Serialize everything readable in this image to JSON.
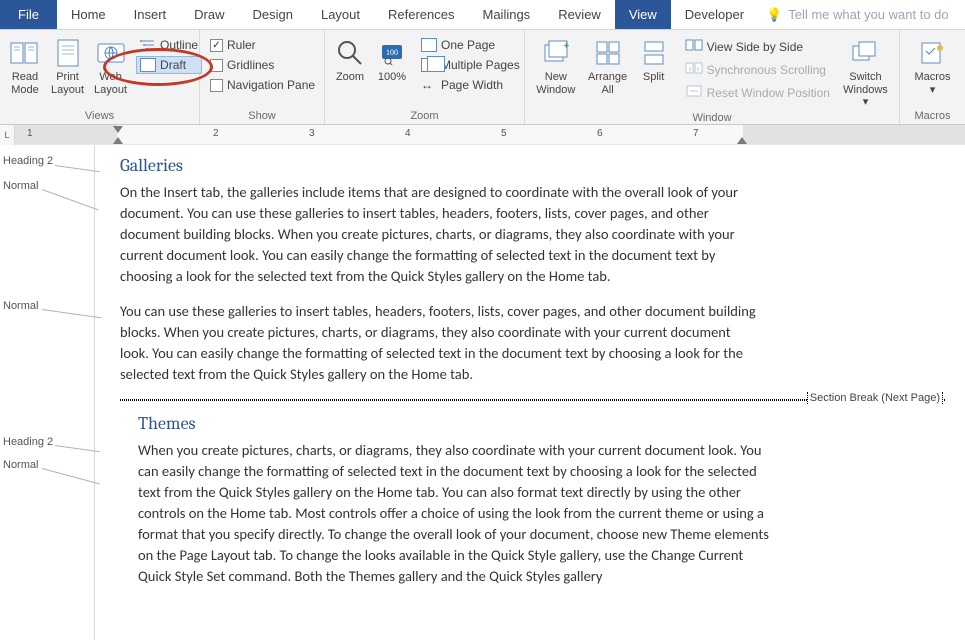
{
  "tabs": {
    "file": "File",
    "home": "Home",
    "insert": "Insert",
    "draw": "Draw",
    "design": "Design",
    "layout": "Layout",
    "references": "References",
    "mailings": "Mailings",
    "review": "Review",
    "view": "View",
    "developer": "Developer",
    "tellme": "Tell me what you want to do"
  },
  "ribbon": {
    "views": {
      "read_mode": "Read Mode",
      "print_layout": "Print Layout",
      "web_layout": "Web Layout",
      "outline": "Outline",
      "draft": "Draft",
      "label": "Views"
    },
    "show": {
      "ruler": "Ruler",
      "gridlines": "Gridlines",
      "nav_pane": "Navigation Pane",
      "label": "Show"
    },
    "zoom": {
      "zoom": "Zoom",
      "p100": "100%",
      "one_page": "One Page",
      "multi_pages": "Multiple Pages",
      "page_width": "Page Width",
      "label": "Zoom"
    },
    "window": {
      "new_window": "New Window",
      "arrange_all": "Arrange All",
      "split": "Split",
      "view_sbs": "View Side by Side",
      "sync_scroll": "Synchronous Scrolling",
      "reset_pos": "Reset Window Position",
      "switch": "Switch Windows",
      "label": "Window"
    },
    "macros": {
      "macros": "Macros",
      "label": "Macros"
    }
  },
  "ruler": {
    "numbers": [
      "1",
      "2",
      "3",
      "4",
      "5",
      "6",
      "7"
    ]
  },
  "styles": {
    "h2": "Heading 2",
    "normal": "Normal"
  },
  "doc": {
    "h_galleries": "Galleries",
    "p1": "On the Insert tab, the galleries include items that are designed to coordinate with the overall look of your document. You can use these galleries to insert tables, headers, footers, lists, cover pages, and other document building blocks. When you create pictures, charts, or diagrams, they also coordinate with your current document look. You can easily change the formatting of selected text in the document text by choosing a look for the selected text from the Quick Styles gallery on the Home tab.",
    "p2": "You can use these galleries to insert tables, headers, footers, lists, cover pages, and other document building blocks. When you create pictures, charts, or diagrams, they also coordinate with your current document look. You can easily change the formatting of selected text in the document text by choosing a look for the selected text from the Quick Styles gallery on the Home tab.",
    "section_break": "Section Break (Next Page)",
    "h_themes": "Themes",
    "p3": "When you create pictures, charts, or diagrams, they also coordinate with your current document look. You can easily change the formatting of selected text in the document text by choosing a look for the selected text from the Quick Styles gallery on the Home tab. You can also format text directly by using the other controls on the Home tab. Most controls offer a choice of using the look from the current theme or using a format that you specify directly. To change the overall look of your document, choose new Theme elements on the Page Layout tab. To change the looks available in the Quick Style gallery, use the Change Current Quick Style Set command. Both the Themes gallery and the Quick Styles gallery"
  }
}
